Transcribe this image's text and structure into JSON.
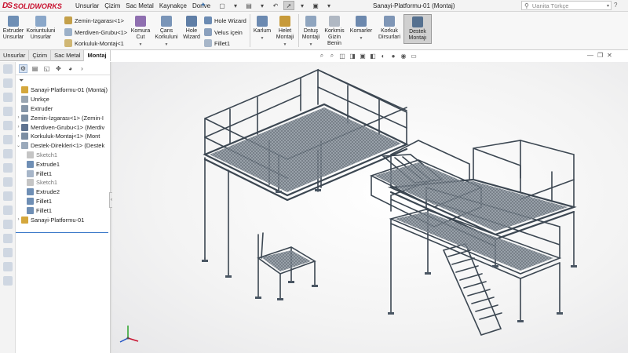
{
  "app": {
    "logo_ds": "DS",
    "logo_name": "SOLIDWORKS"
  },
  "menu": [
    "Unsurlar",
    "Çizim",
    "Sac Metal",
    "Kaynakçe",
    "Dorive"
  ],
  "document_title": "Sanayi-Platformu-01 (Montaj)",
  "search": {
    "placeholder": "Uanita Türkçe"
  },
  "ribbon": {
    "extruder": "Extruder Unsurlar",
    "korunt": "Koriuntuluni Unsurlar",
    "zemin": "Zemin-Izgarası<1>",
    "merdiven": "Merdiven-Grubu<1>",
    "korkuluk": "Korkuluk-Montaj<1",
    "komura": "Komura Cut",
    "cans": "Çans Korkuluni",
    "holewiz": "Hole Wizard",
    "hole_wizard": "Hole Wizard",
    "velus": "Velus içein",
    "fillet": "Fillet1",
    "karlum": "Karlum",
    "helet": "Helet Montaji",
    "dntus": "Dntuş Montaji",
    "korkmis": "Korkmis Gizin Benin",
    "komarler": "Komarler",
    "korkuk_dirs": "Korkuk Dirsurlari",
    "destek": "Destek Montajı"
  },
  "tabs": [
    "Unsurlar",
    "Çizim",
    "Sac Metal",
    "Montaj"
  ],
  "tree": [
    {
      "label": "Sanayi-Platformu-01 (Montaj)",
      "exp": ""
    },
    {
      "label": "Unrkçe",
      "exp": ""
    },
    {
      "label": "Extruder",
      "exp": ""
    },
    {
      "label": "Zemin-İzgarası<1> (Zemin-I",
      "exp": "›"
    },
    {
      "label": "Merdiven-Grubu<1> (Merdiv",
      "exp": "›"
    },
    {
      "label": "Korkuluk-Montaj<1> (Mont",
      "exp": "›"
    },
    {
      "label": "Destek-Direkleri<1> (Destek",
      "exp": "⌄"
    },
    {
      "label": "Sketch1",
      "exp": ""
    },
    {
      "label": "Extrude1",
      "exp": ""
    },
    {
      "label": "Fillet1",
      "exp": ""
    },
    {
      "label": "Sketch1",
      "exp": ""
    },
    {
      "label": "Extrude2",
      "exp": ""
    },
    {
      "label": "Fillet1",
      "exp": ""
    },
    {
      "label": "Fillet1",
      "exp": ""
    },
    {
      "label": "Sanayi-Platformu-01",
      "exp": "›"
    }
  ],
  "colors": {
    "steel": "#5b6b7a",
    "steel_dark": "#3c4752",
    "accent": "#c8102e",
    "grating": "#7d8893"
  }
}
